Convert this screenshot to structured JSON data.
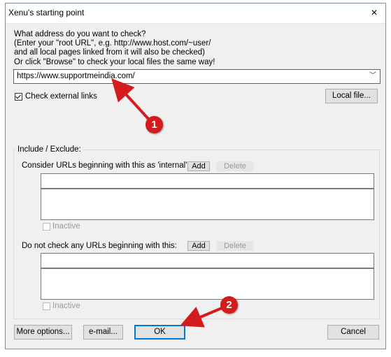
{
  "window": {
    "title": "Xenu's starting point",
    "close_icon": "×"
  },
  "intro_text": "What address do you want to check?\n(Enter your \"root URL\", e.g. http://www.host.com/~user/\nand all local pages linked from it will also be checked)\nOr click \"Browse\" to check your local files the same way!",
  "url_field": {
    "value": "https://www.supportmeindia.com/",
    "dropdown_icon": "﹀"
  },
  "check_external": {
    "label": "Check external links",
    "checked": true
  },
  "local_file_button": "Local file...",
  "include_exclude": {
    "legend": "Include / Exclude:",
    "internal": {
      "label": "Consider URLs beginning with this as 'internal':",
      "add": "Add",
      "delete": "Delete",
      "inactive_label": "Inactive"
    },
    "exclude": {
      "label": "Do not check any URLs beginning with this:",
      "add": "Add",
      "delete": "Delete",
      "inactive_label": "Inactive"
    }
  },
  "buttons": {
    "more_options": "More options...",
    "email": "e-mail...",
    "ok": "OK",
    "cancel": "Cancel"
  },
  "annotations": {
    "badge_1": "1",
    "badge_2": "2",
    "accent_color": "#d51c1c"
  }
}
